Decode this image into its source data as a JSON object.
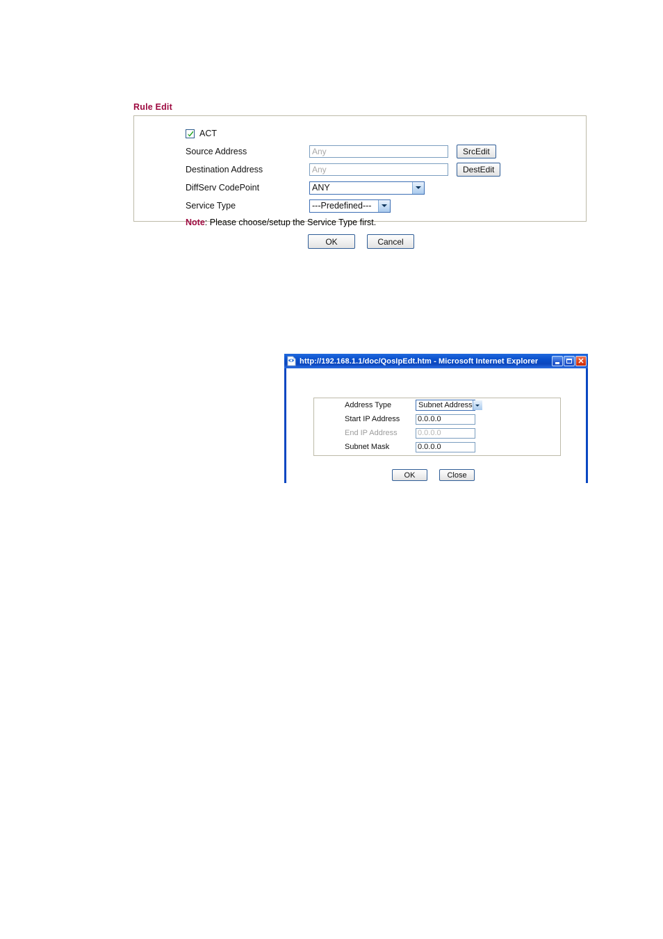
{
  "rule_edit": {
    "title": "Rule Edit",
    "act": {
      "label": "ACT",
      "checked": "true"
    },
    "fields": {
      "source_address": {
        "label": "Source Address",
        "value": "Any",
        "button": "SrcEdit"
      },
      "destination_address": {
        "label": "Destination Address",
        "value": "Any",
        "button": "DestEdit"
      },
      "diffserv_codepoint": {
        "label": "DiffServ CodePoint",
        "selected": "ANY"
      },
      "service_type": {
        "label": "Service Type",
        "selected": "---Predefined---"
      }
    },
    "note": {
      "prefix": "Note",
      "text": ": Please choose/setup the Service Type first."
    },
    "actions": {
      "ok": "OK",
      "cancel": "Cancel"
    }
  },
  "ie_dialog": {
    "title": "http://192.168.1.1/doc/QosIpEdt.htm - Microsoft Internet Explorer",
    "window_buttons": {
      "minimize": "minimize-icon",
      "maximize": "maximize-icon",
      "close": "close-icon"
    },
    "fields": {
      "address_type": {
        "label": "Address Type",
        "selected": "Subnet Address"
      },
      "start_ip": {
        "label": "Start IP Address",
        "value": "0.0.0.0"
      },
      "end_ip": {
        "label": "End IP Address",
        "value": "0.0.0.0",
        "disabled": "true"
      },
      "subnet_mask": {
        "label": "Subnet Mask",
        "value": "0.0.0.0"
      }
    },
    "actions": {
      "ok": "OK",
      "close": "Close"
    }
  },
  "colors": {
    "heading": "#9E0B41",
    "titlebar": "#0A4FCB",
    "box_border": "#BDBAA8",
    "input_border": "#7A9DBF"
  }
}
